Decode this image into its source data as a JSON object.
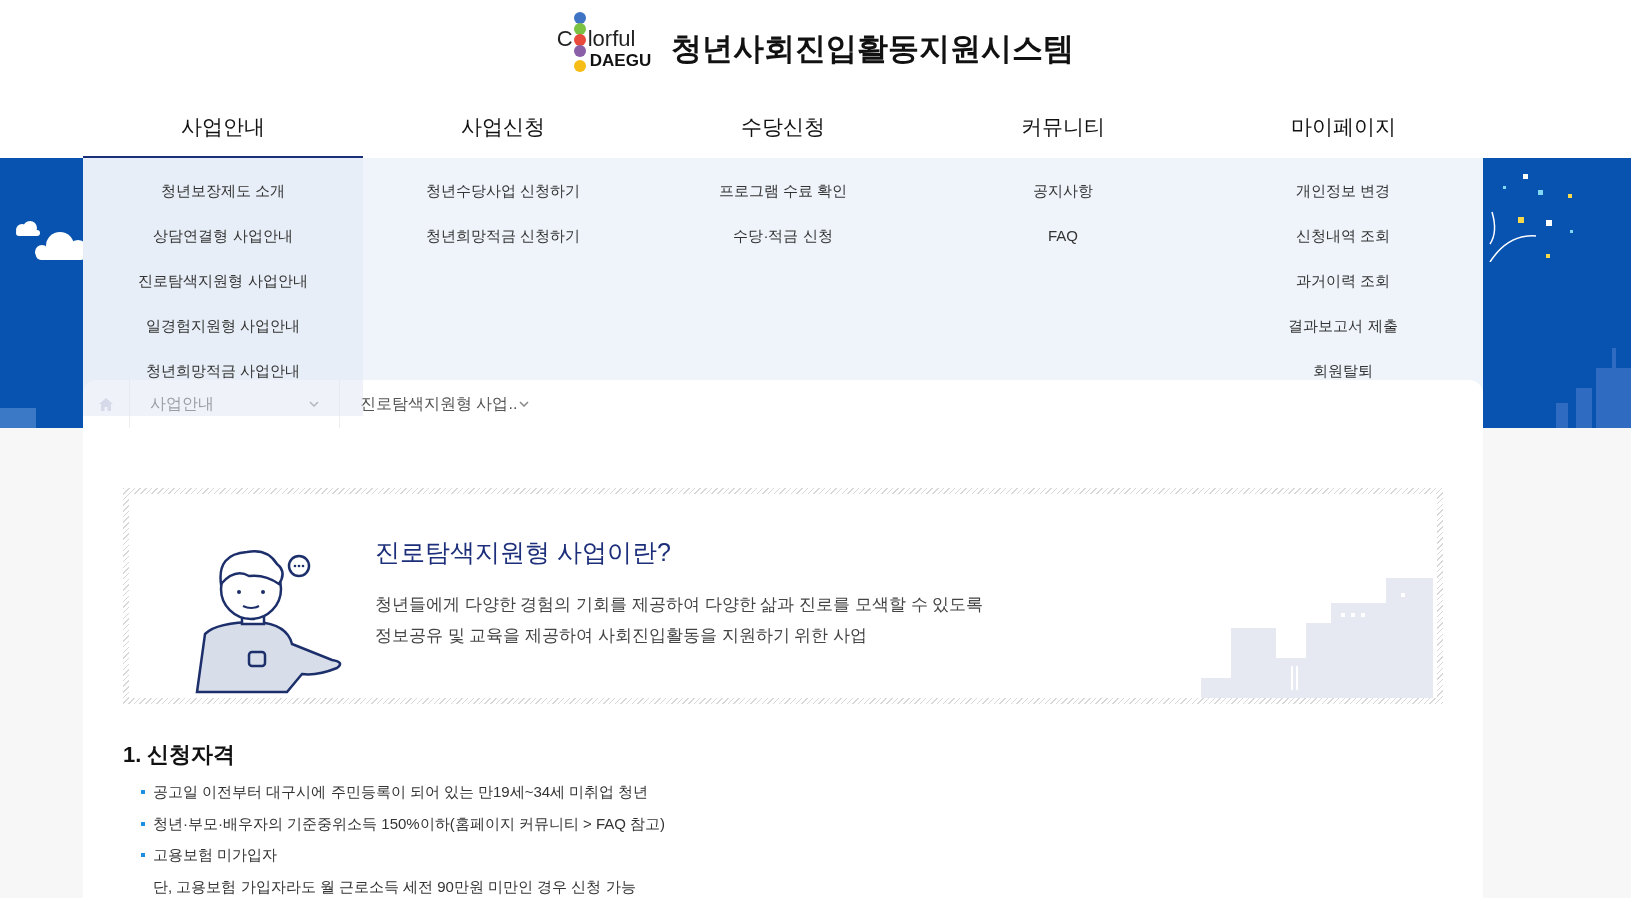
{
  "header": {
    "logo": {
      "line1_start": "C",
      "line1_end": "lorful",
      "line2": "DAEGU"
    },
    "site_title": "청년사회진입활동지원시스템"
  },
  "nav": [
    {
      "label": "사업안내",
      "selected": true,
      "items": [
        "청년보장제도 소개",
        "상담연결형 사업안내",
        "진로탐색지원형 사업안내",
        "일경험지원형 사업안내",
        "청년희망적금 사업안내"
      ]
    },
    {
      "label": "사업신청",
      "selected": false,
      "items": [
        "청년수당사업 신청하기",
        "청년희망적금 신청하기"
      ]
    },
    {
      "label": "수당신청",
      "selected": false,
      "items": [
        "프로그램 수료 확인",
        "수당·적금 신청"
      ]
    },
    {
      "label": "커뮤니티",
      "selected": false,
      "items": [
        "공지사항",
        "FAQ"
      ]
    },
    {
      "label": "마이페이지",
      "selected": false,
      "items": [
        "개인정보 변경",
        "신청내역 조회",
        "과거이력 조회",
        "결과보고서 제출",
        "회원탈퇴"
      ]
    }
  ],
  "breadcrumb": [
    "사업안내",
    "진로탐색지원형 사업.."
  ],
  "intro": {
    "title": "진로탐색지원형 사업이란?",
    "lines": [
      "청년들에게 다양한 경험의 기회를 제공하여 다양한 삶과 진로를 모색할 수 있도록",
      "정보공유 및 교육을 제공하여 사회진입활동을 지원하기 위한 사업"
    ]
  },
  "section": {
    "heading": "1. 신청자격",
    "items": [
      {
        "kind": "bullet",
        "text": "공고일 이전부터 대구시에 주민등록이 되어 있는 만19세~34세 미취업 청년"
      },
      {
        "kind": "bullet",
        "text": "청년·부모·배우자의 기준중위소득 150%이하(홈페이지 커뮤니티 > FAQ 참고)"
      },
      {
        "kind": "bullet",
        "text": "고용보험 미가입자"
      },
      {
        "kind": "note",
        "text": "단, 고용보험 가입자라도 월 근로소득 세전 90만원 미만인 경우 신청 가능"
      }
    ]
  }
}
